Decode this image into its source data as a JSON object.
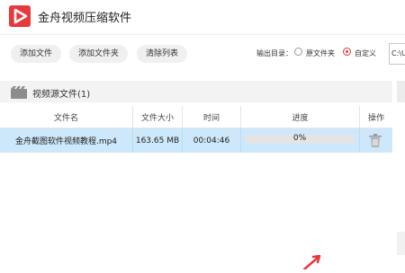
{
  "app": {
    "title": "金舟视频压缩软件"
  },
  "toolbar": {
    "add_file": "添加文件",
    "add_folder": "添加文件夹",
    "clear_list": "清除列表",
    "output_label": "输出目录：",
    "option_source": "原文件夹",
    "option_custom": "自定义",
    "selected_option": "自定义",
    "path_value": "C:\\U"
  },
  "section": {
    "title": "视频源文件(1)"
  },
  "table": {
    "headers": [
      "文件名",
      "文件大小",
      "时间",
      "进度",
      "操作"
    ],
    "rows": [
      {
        "name": "金舟截图软件视频教程.mp4",
        "size": "163.65 MB",
        "duration": "00:04:46",
        "progress_text": "0%",
        "progress": 0
      }
    ]
  },
  "colors": {
    "accent": "#e6393b",
    "row_selected": "#cde8fb",
    "progress": "#4aa3df"
  },
  "icons": {
    "logo": "play-logo-icon",
    "folder": "video-folder-icon",
    "delete": "trash-icon"
  }
}
